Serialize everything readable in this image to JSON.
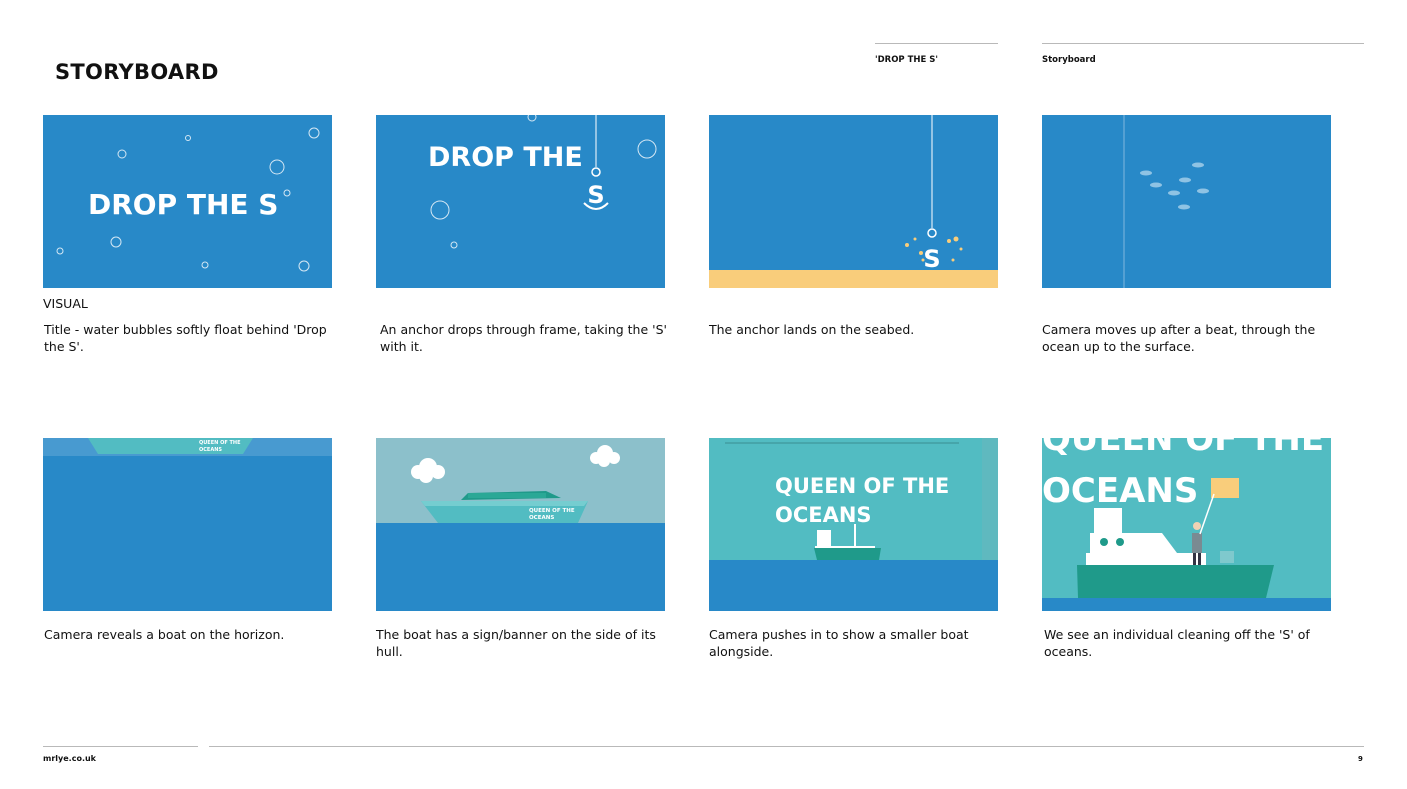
{
  "page_title": "STORYBOARD",
  "header": {
    "project_label": "'DROP THE S'",
    "section_label": "Storyboard"
  },
  "visual_label": "VISUAL",
  "frames": [
    {
      "caption": "Title - water bubbles softly float behind 'Drop the S'.",
      "art_text": "DROP THE S"
    },
    {
      "caption": "An anchor drops through frame, taking the 'S' with it.",
      "art_text": "DROP THE",
      "anchor_letter": "S"
    },
    {
      "caption": "The anchor lands on the seabed.",
      "anchor_letter": "S"
    },
    {
      "caption": "Camera moves up after a beat, through the ocean up to the surface."
    },
    {
      "caption": "Camera reveals a boat on the horizon.",
      "hull_text_1": "QUEEN OF THE",
      "hull_text_2": "OCEANS"
    },
    {
      "caption": "The boat has a sign/banner on the side of its hull.",
      "hull_text_1": "QUEEN OF THE",
      "hull_text_2": "OCEANS"
    },
    {
      "caption": "Camera pushes in to show a smaller boat alongside.",
      "sign_text_1": "QUEEN OF THE",
      "sign_text_2": "OCEANS"
    },
    {
      "caption": "We see an individual cleaning off the 'S' of oceans.",
      "sign_text_1": "QUEEN OF THE",
      "sign_text_2": "OCEANS"
    }
  ],
  "footer": {
    "website": "mrlye.co.uk",
    "page_number": "9"
  },
  "colors": {
    "ocean_blue": "#2889c8",
    "sky_grey_blue": "#8cc0cb",
    "teal": "#52bcc2",
    "dark_teal": "#1f9a8a",
    "sand": "#f9cd7b",
    "white": "#ffffff"
  }
}
